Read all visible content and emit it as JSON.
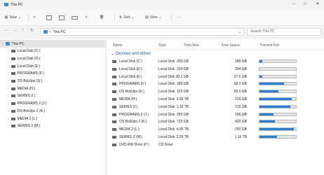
{
  "window": {
    "title": "This PC"
  },
  "toolbar": {
    "new_label": "New",
    "sort_label": "Sort",
    "view_label": "View",
    "more_label": "···"
  },
  "address": {
    "path": "This PC",
    "search_placeholder": "Search This PC"
  },
  "sidebar": {
    "items": [
      "This PC",
      "Local Disk (C:)",
      "Local Disk (D:)",
      "Local Disk (E:)",
      "PROGRAMS (F:)",
      "OS BckUps (G:)",
      "MEDIA (H:)",
      "SERIES (I:)",
      "PROGRAMS 2 (J:)",
      "OS BckUps 2 (K:)",
      "MEDIA 2 (L:)",
      "SERIES 2 (M:)"
    ]
  },
  "columns": {
    "name": "Name",
    "type": "Type",
    "total": "Total Size",
    "free": "Free Space",
    "percent": "Percent Full"
  },
  "group": {
    "label": "Devices and drives"
  },
  "drives": [
    {
      "name": "Local Disk (C:)",
      "type": "Local Disk",
      "total": "200 GB",
      "free": "186 GB",
      "pct": 0.07
    },
    {
      "name": "Local Disk (D:)",
      "type": "Local Disk",
      "total": "234 GB",
      "free": "234 GB",
      "pct": 0.0
    },
    {
      "name": "Local Disk (E:)",
      "type": "Local Disk",
      "total": "30.1 GB",
      "free": "27.6 GB",
      "pct": 0.08
    },
    {
      "name": "PROGRAMS (F:)",
      "type": "Local Disk",
      "total": "180 GB",
      "free": "58.2 GB",
      "pct": 0.68
    },
    {
      "name": "OS BckUps (G:)",
      "type": "Local Disk",
      "total": "120 GB",
      "free": "58.0 GB",
      "pct": 0.52
    },
    {
      "name": "MEDIA (H:)",
      "type": "Local Disk",
      "total": "2.00 TB",
      "free": "215 GB",
      "pct": 0.89
    },
    {
      "name": "SERIES (I:)",
      "type": "Local Disk",
      "total": "1.33 TB",
      "free": "215 GB",
      "pct": 0.84
    },
    {
      "name": "PROGRAMS 2 (J:)",
      "type": "Local Disk",
      "total": "250 GB",
      "free": "156 GB",
      "pct": 0.38
    },
    {
      "name": "OS BckUps 2 (K:)",
      "type": "Local Disk",
      "total": "720 GB",
      "free": "420 GB",
      "pct": 0.42
    },
    {
      "name": "MEDIA 2 (L:)",
      "type": "Local Disk",
      "total": "4.00 TB",
      "free": "250 GB",
      "pct": 0.94
    },
    {
      "name": "SERIES 2 (M:)",
      "type": "Local Disk",
      "total": "2.29 TB",
      "free": "1.16 TB",
      "pct": 0.49
    },
    {
      "name": "DVD RW Drive (P:)",
      "type": "CD Drive",
      "total": "",
      "free": "",
      "pct": null
    }
  ],
  "colors": {
    "accent": "#2a7fd4",
    "link": "#1e5a9c"
  }
}
